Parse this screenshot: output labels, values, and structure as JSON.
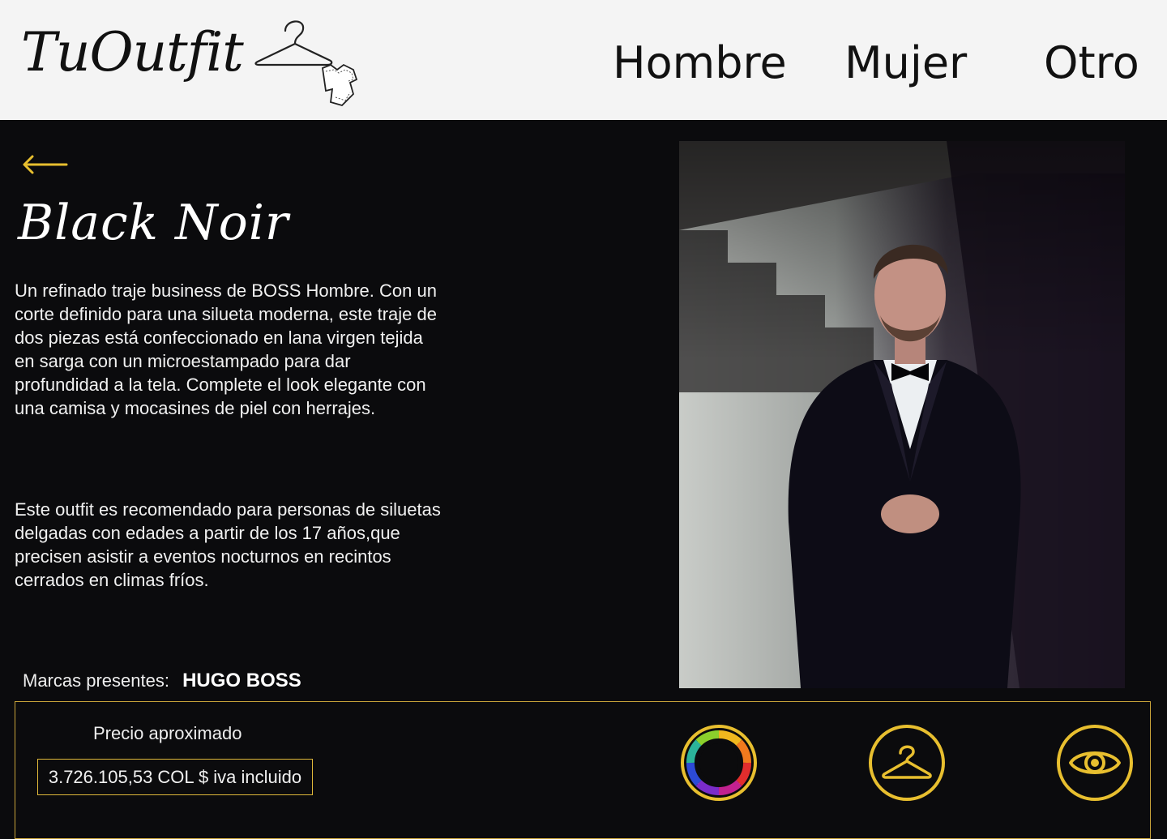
{
  "header": {
    "logo_text": "TuOutfit",
    "nav": [
      {
        "label": "Hombre"
      },
      {
        "label": "Mujer"
      },
      {
        "label": "Otro"
      }
    ]
  },
  "outfit": {
    "title": "Black Noir",
    "description": "Un refinado traje business de BOSS Hombre. Con un corte definido para una silueta moderna, este traje de dos piezas está confeccionado en lana virgen tejida en sarga con un microestampado para dar profundidad a la tela. Complete el look elegante con una camisa y mocasines de piel con herrajes.",
    "recommendation": "Este outfit es recomendado para personas de siluetas delgadas con edades a partir de los 17 años,que precisen asistir a eventos nocturnos en recintos cerrados en climas fríos.",
    "brands_label": "Marcas presentes:",
    "brands_value": "HUGO BOSS"
  },
  "price": {
    "label": "Precio aproximado",
    "value": "3.726.105,53 COL $ iva incluido"
  },
  "icons": {
    "back": "back-arrow-icon",
    "colors": "color-wheel-icon",
    "hanger": "hanger-icon",
    "view": "eye-icon"
  },
  "colors": {
    "accent": "#e8bf2f",
    "background": "#0b0b0d",
    "header_bg": "#f4f4f4"
  }
}
